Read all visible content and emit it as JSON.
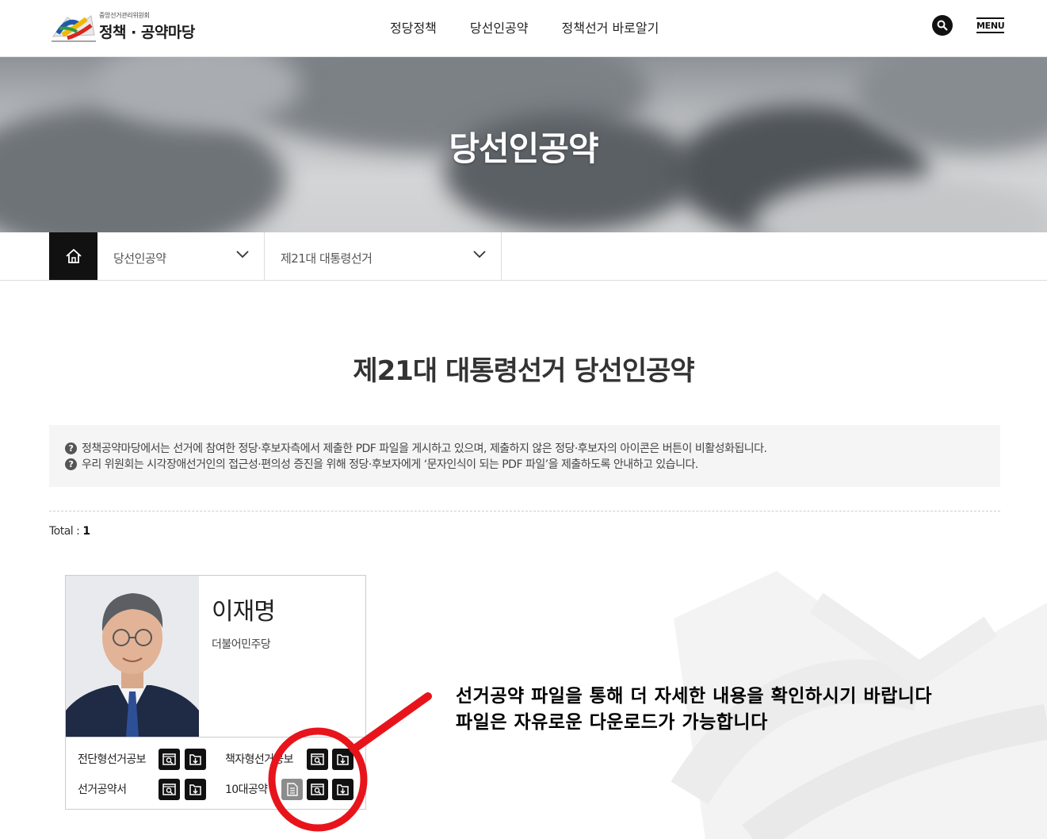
{
  "header": {
    "logo_sub": "중앙선거관리위원회",
    "logo_main": "정책 · 공약마당",
    "nav": [
      "정당정책",
      "당선인공약",
      "정책선거 바로알기"
    ],
    "search_icon": "search-icon",
    "menu_label": "MENU"
  },
  "banner": {
    "title": "당선인공약"
  },
  "location": {
    "home_icon": "home-icon",
    "depth1": "당선인공약",
    "depth2": "제21대 대통령선거"
  },
  "main": {
    "title": "제21대 대통령선거 당선인공약",
    "notices": [
      "정책공약마당에서는 선거에 참여한 정당·후보자측에서 제출한 PDF 파일을 게시하고 있으며, 제출하지 않은 정당·후보자의 아이콘은 버튼이 비활성화됩니다.",
      "우리 위원회는 시각장애선거인의 접근성·편의성 증진을 위해 정당·후보자에게 ‘문자인식이 되는 PDF 파일’을 제출하도록 안내하고 있습니다."
    ],
    "total_label": "Total :",
    "total_count": "1"
  },
  "candidate": {
    "name": "이재명",
    "party": "더불어민주당",
    "docs": {
      "leaflet": "전단형선거공보",
      "booklet": "책자형선거공보",
      "pledge_book": "선거공약서",
      "top10": "10대공약"
    }
  },
  "annotation": {
    "line1": "선거공약 파일을 통해 더 자세한 내용을 확인하시기 바랍니다",
    "line2": "파일은 자유로운 다운로드가 가능합니다",
    "color": "#e8141b"
  }
}
